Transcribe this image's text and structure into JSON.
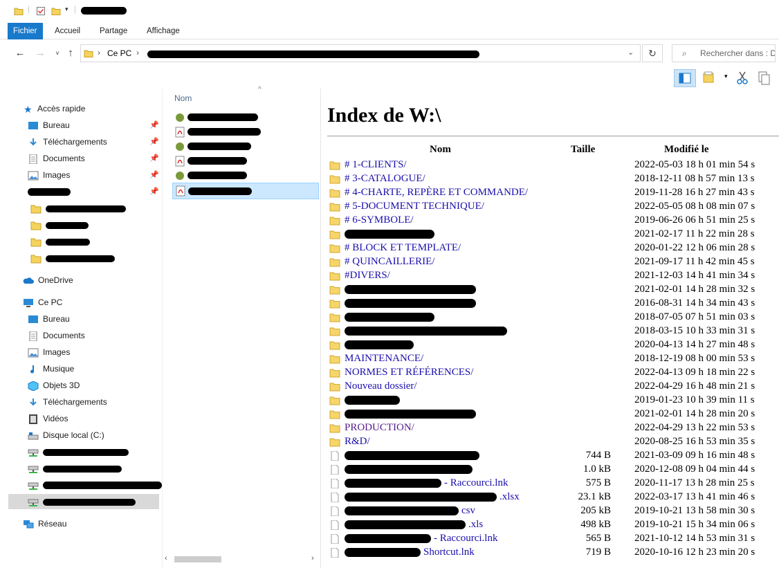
{
  "titlebar": {
    "title_redacted": true
  },
  "ribbon": {
    "tabs": [
      "Fichier",
      "Accueil",
      "Partage",
      "Affichage"
    ]
  },
  "address": {
    "crumb_root": "Ce PC",
    "search_placeholder": "Rechercher dans : DIO"
  },
  "nav": {
    "quick_access": "Accès rapide",
    "qa_items": [
      {
        "label": "Bureau",
        "icon": "desktop-icon"
      },
      {
        "label": "Téléchargements",
        "icon": "download-arrow-icon"
      },
      {
        "label": "Documents",
        "icon": "document-icon"
      },
      {
        "label": "Images",
        "icon": "pictures-icon"
      }
    ],
    "onedrive": "OneDrive",
    "this_pc": "Ce PC",
    "pc_items": [
      {
        "label": "Bureau",
        "icon": "desktop-icon"
      },
      {
        "label": "Documents",
        "icon": "document-icon"
      },
      {
        "label": "Images",
        "icon": "pictures-icon"
      },
      {
        "label": "Musique",
        "icon": "music-note-icon"
      },
      {
        "label": "Objets 3D",
        "icon": "cube-3d-icon"
      },
      {
        "label": "Téléchargements",
        "icon": "download-arrow-icon"
      },
      {
        "label": "Vidéos",
        "icon": "video-film-icon"
      },
      {
        "label": "Disque local (C:)",
        "icon": "local-disk-icon"
      }
    ],
    "network": "Réseau"
  },
  "filelist": {
    "column_header": "Nom"
  },
  "index": {
    "title": "Index de W:\\",
    "headers": {
      "name": "Nom",
      "size": "Taille",
      "modified": "Modifié le"
    },
    "rows": [
      {
        "name": "# 1-CLIENTS/",
        "size": "",
        "date": "2022-05-03 18 h 01 min 54 s",
        "type": "folder"
      },
      {
        "name": "# 3-CATALOGUE/",
        "size": "",
        "date": "2018-12-11 08 h 57 min 13 s",
        "type": "folder"
      },
      {
        "name": "# 4-CHARTE, REPÈRE ET COMMANDE/",
        "size": "",
        "date": "2019-11-28 16 h 27 min 43 s",
        "type": "folder"
      },
      {
        "name": "# 5-DOCUMENT TECHNIQUE/",
        "size": "",
        "date": "2022-05-05 08 h 08 min 07 s",
        "type": "folder"
      },
      {
        "name": "# 6-SYMBOLE/",
        "size": "",
        "date": "2019-06-26 06 h 51 min 25 s",
        "type": "folder"
      },
      {
        "name": "",
        "size": "",
        "date": "2021-02-17 11 h 22 min 28 s",
        "type": "folder",
        "redacted": 130
      },
      {
        "name": "# BLOCK ET TEMPLATE/",
        "size": "",
        "date": "2020-01-22 12 h 06 min 28 s",
        "type": "folder"
      },
      {
        "name": "# QUINCAILLERIE/",
        "size": "",
        "date": "2021-09-17 11 h 42 min 45 s",
        "type": "folder"
      },
      {
        "name": "#DIVERS/",
        "size": "",
        "date": "2021-12-03 14 h 41 min 34 s",
        "type": "folder"
      },
      {
        "name": "",
        "size": "",
        "date": "2021-02-01 14 h 28 min 32 s",
        "type": "folder",
        "redacted": 190
      },
      {
        "name": "",
        "size": "",
        "date": "2016-08-31 14 h 34 min 43 s",
        "type": "folder",
        "redacted": 190
      },
      {
        "name": "",
        "size": "",
        "date": "2018-07-05 07 h 51 min 03 s",
        "type": "folder",
        "redacted": 130
      },
      {
        "name": "",
        "size": "",
        "date": "2018-03-15 10 h 33 min 31 s",
        "type": "folder",
        "redacted": 235
      },
      {
        "name": "",
        "size": "",
        "date": "2020-04-13 14 h 27 min 48 s",
        "type": "folder",
        "redacted": 100
      },
      {
        "name": "MAINTENANCE/",
        "size": "",
        "date": "2018-12-19 08 h 00 min 53 s",
        "type": "folder"
      },
      {
        "name": "NORMES ET RÉFÉRENCES/",
        "size": "",
        "date": "2022-04-13 09 h 18 min 22 s",
        "type": "folder"
      },
      {
        "name": "Nouveau dossier/",
        "size": "",
        "date": "2022-04-29 16 h 48 min 21 s",
        "type": "folder"
      },
      {
        "name": "",
        "size": "",
        "date": "2019-01-23 10 h 39 min 11 s",
        "type": "folder",
        "redacted": 80
      },
      {
        "name": "",
        "size": "",
        "date": "2021-02-01 14 h 28 min 20 s",
        "type": "folder",
        "redacted": 190
      },
      {
        "name": "PRODUCTION/",
        "size": "",
        "date": "2022-04-29 13 h 22 min 53 s",
        "type": "folder",
        "visited": true
      },
      {
        "name": "R&D/",
        "size": "",
        "date": "2020-08-25 16 h 53 min 35 s",
        "type": "folder"
      },
      {
        "name": "",
        "size": "744 B",
        "date": "2021-03-09 09 h 16 min 48 s",
        "type": "file",
        "redacted": 195
      },
      {
        "name": "",
        "size": "1.0 kB",
        "date": "2020-12-08 09 h 04 min 44 s",
        "type": "file",
        "redacted": 185
      },
      {
        "name": "- Raccourci.lnk",
        "size": "575 B",
        "date": "2020-11-17 13 h 28 min 25 s",
        "type": "file",
        "redacted": 140
      },
      {
        "name": ".xlsx",
        "size": "23.1 kB",
        "date": "2022-03-17 13 h 41 min 46 s",
        "type": "file",
        "redacted": 220
      },
      {
        "name": "csv",
        "size": "205 kB",
        "date": "2019-10-21 13 h 58 min 30 s",
        "type": "file",
        "redacted": 165
      },
      {
        "name": ".xls",
        "size": "498 kB",
        "date": "2019-10-21 15 h 34 min 06 s",
        "type": "file",
        "redacted": 175
      },
      {
        "name": "- Raccourci.lnk",
        "size": "565 B",
        "date": "2021-10-12 14 h 53 min 31 s",
        "type": "file",
        "redacted": 125
      },
      {
        "name": "Shortcut.lnk",
        "size": "719 B",
        "date": "2020-10-16 12 h 23 min 20 s",
        "type": "file",
        "redacted": 110
      }
    ]
  }
}
